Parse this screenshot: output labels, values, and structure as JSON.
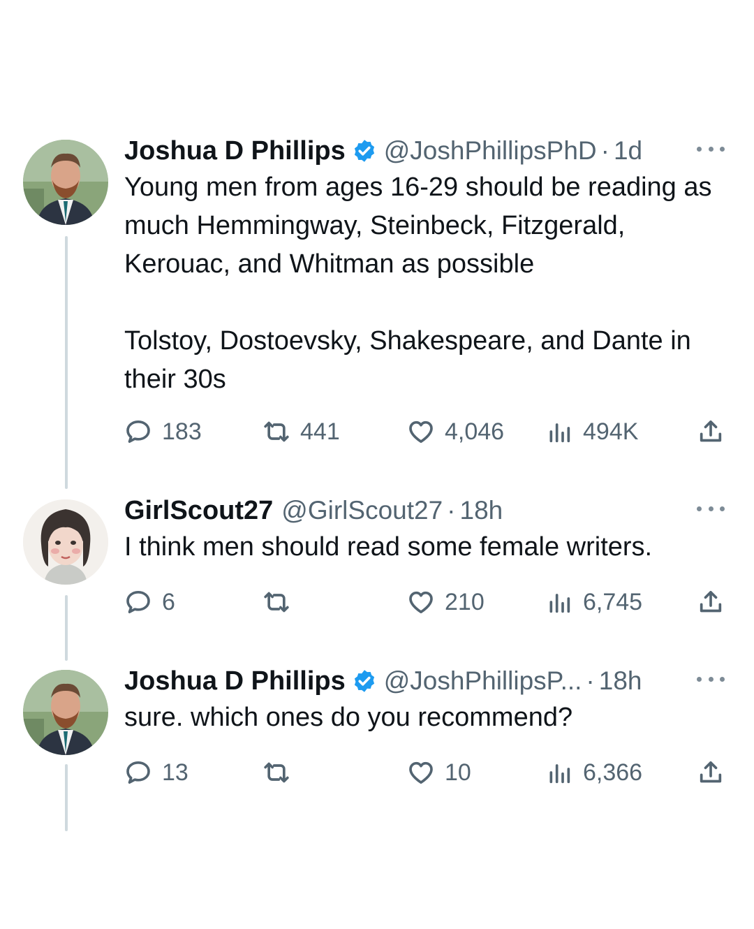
{
  "colors": {
    "verified": "#1d9bf0",
    "text": "#0f1419",
    "secondary": "#536471",
    "thread_line": "#cfd9de"
  },
  "icons": {
    "reply": "speech-bubble-icon",
    "retweet": "retweet-arrows-icon",
    "like": "heart-icon",
    "views": "bar-chart-icon",
    "share": "upload-arrow-icon",
    "more": "ellipsis-icon",
    "verified": "verified-badge-icon"
  },
  "tweets": [
    {
      "name": "Joshua D Phillips",
      "verified": true,
      "handle": "@JoshPhillipsPhD",
      "dot": "·",
      "time": "1d",
      "text": "Young men from ages 16-29 should be reading as much Hemmingway, Steinbeck, Fitzgerald, Kerouac, and Whitman as possible\n\nTolstoy, Dostoevsky, Shakespeare, and Dante in their 30s",
      "replies": "183",
      "retweets": "441",
      "likes": "4,046",
      "views": "494K"
    },
    {
      "name": "GirlScout27",
      "verified": false,
      "handle": "@GirlScout27",
      "dot": "·",
      "time": "18h",
      "text": "I think men should read some female writers.",
      "replies": "6",
      "retweets": "",
      "likes": "210",
      "views": "6,745"
    },
    {
      "name": "Joshua D Phillips",
      "verified": true,
      "handle": "@JoshPhillipsP...",
      "dot": "·",
      "time": "18h",
      "text": "sure. which ones do you recommend?",
      "replies": "13",
      "retweets": "",
      "likes": "10",
      "views": "6,366"
    }
  ]
}
